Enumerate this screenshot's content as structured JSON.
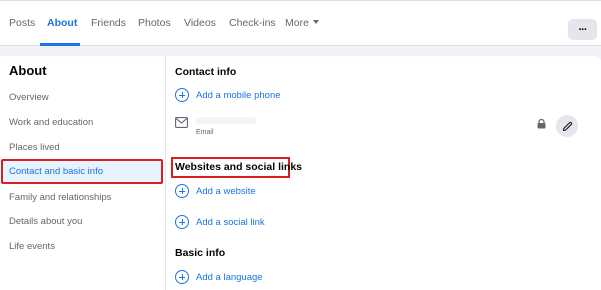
{
  "tabs": [
    {
      "label": "Posts"
    },
    {
      "label": "About"
    },
    {
      "label": "Friends"
    },
    {
      "label": "Photos"
    },
    {
      "label": "Videos"
    },
    {
      "label": "Check-ins"
    },
    {
      "label": "More"
    }
  ],
  "more_button": {
    "label": "···"
  },
  "sidebar": {
    "title": "About",
    "items": [
      {
        "label": "Overview"
      },
      {
        "label": "Work and education"
      },
      {
        "label": "Places lived"
      },
      {
        "label": "Contact and basic info"
      },
      {
        "label": "Family and relationships"
      },
      {
        "label": "Details about you"
      },
      {
        "label": "Life events"
      }
    ]
  },
  "main": {
    "contact_info": {
      "title": "Contact info",
      "add_mobile": "Add a mobile phone",
      "email_caption": "Email"
    },
    "websites": {
      "title": "Websites and social links",
      "add_website": "Add a website",
      "add_social": "Add a social link"
    },
    "basic_info": {
      "title": "Basic info",
      "add_language": "Add a language"
    }
  },
  "colors": {
    "accent": "#1b74e4",
    "highlight_border": "#d9201f",
    "background": "#f0f2f5",
    "muted_text": "#65676b"
  },
  "icons": [
    "plus-circle-icon",
    "envelope-icon",
    "lock-icon",
    "pencil-icon",
    "caret-down-icon",
    "more-horizontal-icon"
  ]
}
